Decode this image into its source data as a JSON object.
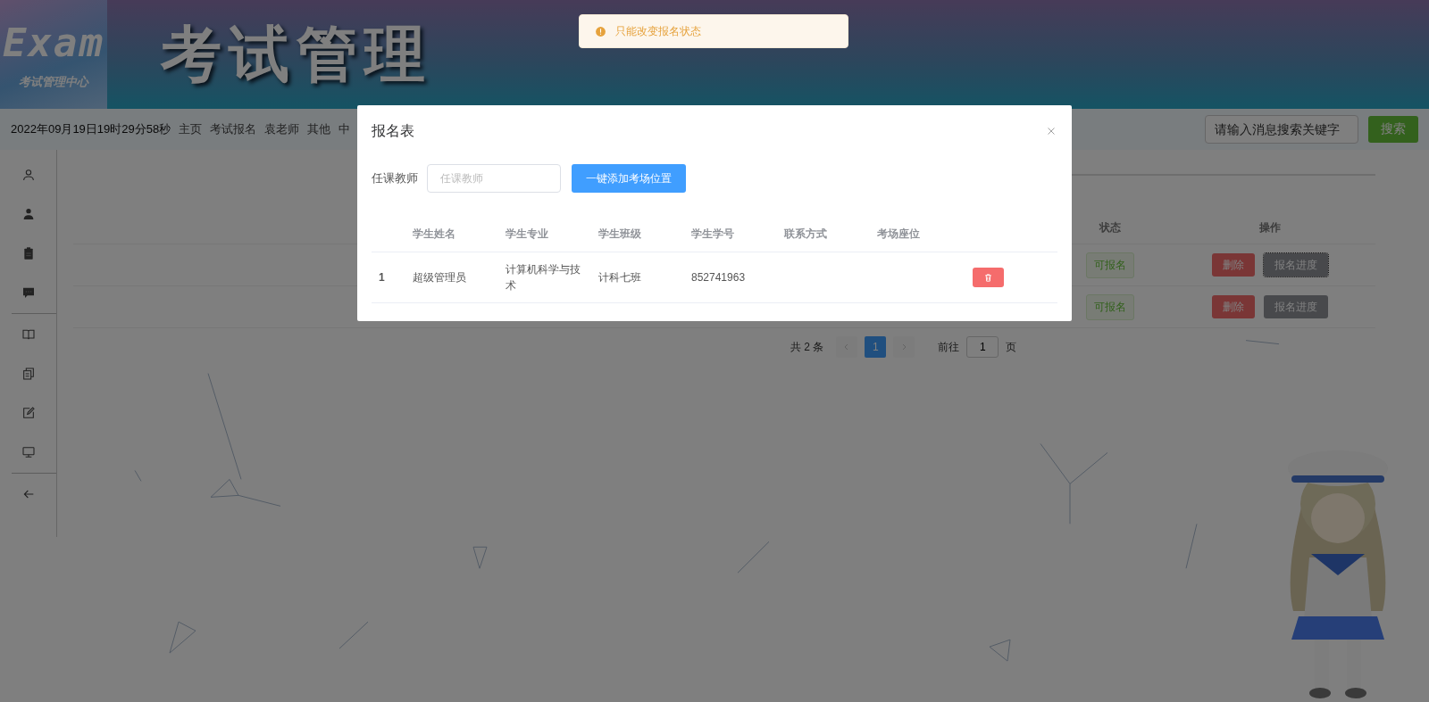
{
  "header": {
    "logo_text": "Exam",
    "logo_subtitle": "考试管理中心",
    "title": "考试管理"
  },
  "nav": {
    "datetime": "2022年09月19日19时29分58秒",
    "links": [
      "主页",
      "考试报名",
      "袁老师",
      "其他",
      "中"
    ],
    "search": {
      "placeholder": "请输入消息搜索关键字"
    },
    "search_button": "搜索"
  },
  "table": {
    "columns": [
      "状态",
      "操作"
    ],
    "rows": [
      {
        "status": "可报名",
        "actions": [
          {
            "label": "删除",
            "kind": "danger",
            "focused": false
          },
          {
            "label": "报名进度",
            "kind": "info",
            "focused": true
          }
        ]
      },
      {
        "status": "可报名",
        "actions": [
          {
            "label": "删除",
            "kind": "danger",
            "focused": false
          },
          {
            "label": "报名进度",
            "kind": "info",
            "focused": false
          }
        ]
      }
    ]
  },
  "pagination": {
    "total": "共 2 条",
    "prev_disabled": true,
    "pages": [
      {
        "label": "1",
        "selected": true
      }
    ],
    "next_disabled": true,
    "goto_label": "前往",
    "goto_value": "1",
    "page_suffix": "页"
  },
  "dialog": {
    "title": "报名表",
    "form": {
      "label": "任课教师",
      "placeholder": "任课教师"
    },
    "add_button": "一键添加考场位置",
    "table": {
      "columns": [
        "学生姓名",
        "学生专业",
        "学生班级",
        "学生学号",
        "联系方式",
        "考场座位"
      ],
      "rows": [
        {
          "index": "1",
          "name": "超级管理员",
          "major": "计算机科学与技术",
          "class": "计科七班",
          "student_id": "852741963"
        }
      ]
    }
  },
  "toast": {
    "kind": "warning",
    "text": "只能改变报名状态"
  }
}
